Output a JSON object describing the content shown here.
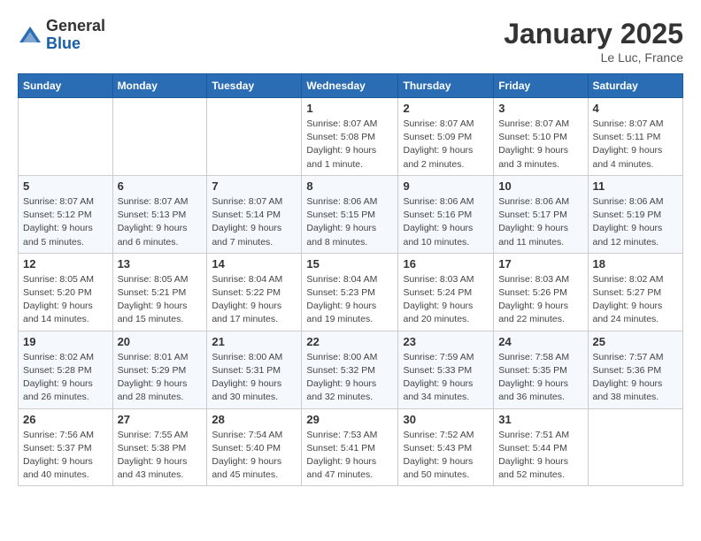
{
  "logo": {
    "general": "General",
    "blue": "Blue"
  },
  "title": "January 2025",
  "location": "Le Luc, France",
  "days_of_week": [
    "Sunday",
    "Monday",
    "Tuesday",
    "Wednesday",
    "Thursday",
    "Friday",
    "Saturday"
  ],
  "weeks": [
    [
      {
        "day": "",
        "info": ""
      },
      {
        "day": "",
        "info": ""
      },
      {
        "day": "",
        "info": ""
      },
      {
        "day": "1",
        "info": "Sunrise: 8:07 AM\nSunset: 5:08 PM\nDaylight: 9 hours\nand 1 minute."
      },
      {
        "day": "2",
        "info": "Sunrise: 8:07 AM\nSunset: 5:09 PM\nDaylight: 9 hours\nand 2 minutes."
      },
      {
        "day": "3",
        "info": "Sunrise: 8:07 AM\nSunset: 5:10 PM\nDaylight: 9 hours\nand 3 minutes."
      },
      {
        "day": "4",
        "info": "Sunrise: 8:07 AM\nSunset: 5:11 PM\nDaylight: 9 hours\nand 4 minutes."
      }
    ],
    [
      {
        "day": "5",
        "info": "Sunrise: 8:07 AM\nSunset: 5:12 PM\nDaylight: 9 hours\nand 5 minutes."
      },
      {
        "day": "6",
        "info": "Sunrise: 8:07 AM\nSunset: 5:13 PM\nDaylight: 9 hours\nand 6 minutes."
      },
      {
        "day": "7",
        "info": "Sunrise: 8:07 AM\nSunset: 5:14 PM\nDaylight: 9 hours\nand 7 minutes."
      },
      {
        "day": "8",
        "info": "Sunrise: 8:06 AM\nSunset: 5:15 PM\nDaylight: 9 hours\nand 8 minutes."
      },
      {
        "day": "9",
        "info": "Sunrise: 8:06 AM\nSunset: 5:16 PM\nDaylight: 9 hours\nand 10 minutes."
      },
      {
        "day": "10",
        "info": "Sunrise: 8:06 AM\nSunset: 5:17 PM\nDaylight: 9 hours\nand 11 minutes."
      },
      {
        "day": "11",
        "info": "Sunrise: 8:06 AM\nSunset: 5:19 PM\nDaylight: 9 hours\nand 12 minutes."
      }
    ],
    [
      {
        "day": "12",
        "info": "Sunrise: 8:05 AM\nSunset: 5:20 PM\nDaylight: 9 hours\nand 14 minutes."
      },
      {
        "day": "13",
        "info": "Sunrise: 8:05 AM\nSunset: 5:21 PM\nDaylight: 9 hours\nand 15 minutes."
      },
      {
        "day": "14",
        "info": "Sunrise: 8:04 AM\nSunset: 5:22 PM\nDaylight: 9 hours\nand 17 minutes."
      },
      {
        "day": "15",
        "info": "Sunrise: 8:04 AM\nSunset: 5:23 PM\nDaylight: 9 hours\nand 19 minutes."
      },
      {
        "day": "16",
        "info": "Sunrise: 8:03 AM\nSunset: 5:24 PM\nDaylight: 9 hours\nand 20 minutes."
      },
      {
        "day": "17",
        "info": "Sunrise: 8:03 AM\nSunset: 5:26 PM\nDaylight: 9 hours\nand 22 minutes."
      },
      {
        "day": "18",
        "info": "Sunrise: 8:02 AM\nSunset: 5:27 PM\nDaylight: 9 hours\nand 24 minutes."
      }
    ],
    [
      {
        "day": "19",
        "info": "Sunrise: 8:02 AM\nSunset: 5:28 PM\nDaylight: 9 hours\nand 26 minutes."
      },
      {
        "day": "20",
        "info": "Sunrise: 8:01 AM\nSunset: 5:29 PM\nDaylight: 9 hours\nand 28 minutes."
      },
      {
        "day": "21",
        "info": "Sunrise: 8:00 AM\nSunset: 5:31 PM\nDaylight: 9 hours\nand 30 minutes."
      },
      {
        "day": "22",
        "info": "Sunrise: 8:00 AM\nSunset: 5:32 PM\nDaylight: 9 hours\nand 32 minutes."
      },
      {
        "day": "23",
        "info": "Sunrise: 7:59 AM\nSunset: 5:33 PM\nDaylight: 9 hours\nand 34 minutes."
      },
      {
        "day": "24",
        "info": "Sunrise: 7:58 AM\nSunset: 5:35 PM\nDaylight: 9 hours\nand 36 minutes."
      },
      {
        "day": "25",
        "info": "Sunrise: 7:57 AM\nSunset: 5:36 PM\nDaylight: 9 hours\nand 38 minutes."
      }
    ],
    [
      {
        "day": "26",
        "info": "Sunrise: 7:56 AM\nSunset: 5:37 PM\nDaylight: 9 hours\nand 40 minutes."
      },
      {
        "day": "27",
        "info": "Sunrise: 7:55 AM\nSunset: 5:38 PM\nDaylight: 9 hours\nand 43 minutes."
      },
      {
        "day": "28",
        "info": "Sunrise: 7:54 AM\nSunset: 5:40 PM\nDaylight: 9 hours\nand 45 minutes."
      },
      {
        "day": "29",
        "info": "Sunrise: 7:53 AM\nSunset: 5:41 PM\nDaylight: 9 hours\nand 47 minutes."
      },
      {
        "day": "30",
        "info": "Sunrise: 7:52 AM\nSunset: 5:43 PM\nDaylight: 9 hours\nand 50 minutes."
      },
      {
        "day": "31",
        "info": "Sunrise: 7:51 AM\nSunset: 5:44 PM\nDaylight: 9 hours\nand 52 minutes."
      },
      {
        "day": "",
        "info": ""
      }
    ]
  ]
}
